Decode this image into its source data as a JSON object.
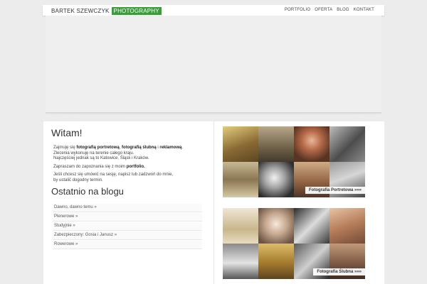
{
  "site": {
    "brand_name": "BARTEK SZEWCZYK",
    "brand_tag": "PHOTOGRAPHY",
    "nav": [
      {
        "label": "PORTFOLIO"
      },
      {
        "label": "OFERTA"
      },
      {
        "label": "BLOG"
      },
      {
        "label": "KONTAKT"
      }
    ],
    "accent_color": "#3d9a3d"
  },
  "welcome": {
    "title": "Witam!",
    "p1_prefix": "Zajmuję się ",
    "p1_b1": "fotografią portretową",
    "p1_sep1": ", ",
    "p1_b2": "fotografią ślubną",
    "p1_sep2": " i ",
    "p1_b3": "reklamową",
    "p1_suffix": ".",
    "p1_line2": "Zlecenia wykonuję na terenie całego kraju.",
    "p1_line3": "Najczęściej jednak są to Katowice, Śląsk i Kraków.",
    "p2_prefix": "Zapraszam do zapoznania się z moim ",
    "p2_link": "portfolio.",
    "p3_line1": "Jeśli chcesz się umówić na sesję, napisz lub zadzwoń do mnie,",
    "p3_line2": "by ustalić dogodny termin."
  },
  "blog": {
    "title": "Ostatnio na blogu",
    "posts": [
      {
        "label": "Dawno, dawno temu »"
      },
      {
        "label": "Plenerowe »"
      },
      {
        "label": "Studyjnie »"
      },
      {
        "label": "Zabezpieczony: Gosia i Janusz »"
      },
      {
        "label": "Rowerowe »"
      }
    ]
  },
  "galleries": [
    {
      "label": "Fotografia Portretowa »»»"
    },
    {
      "label": "Fotografia Ślubna »»»"
    }
  ]
}
